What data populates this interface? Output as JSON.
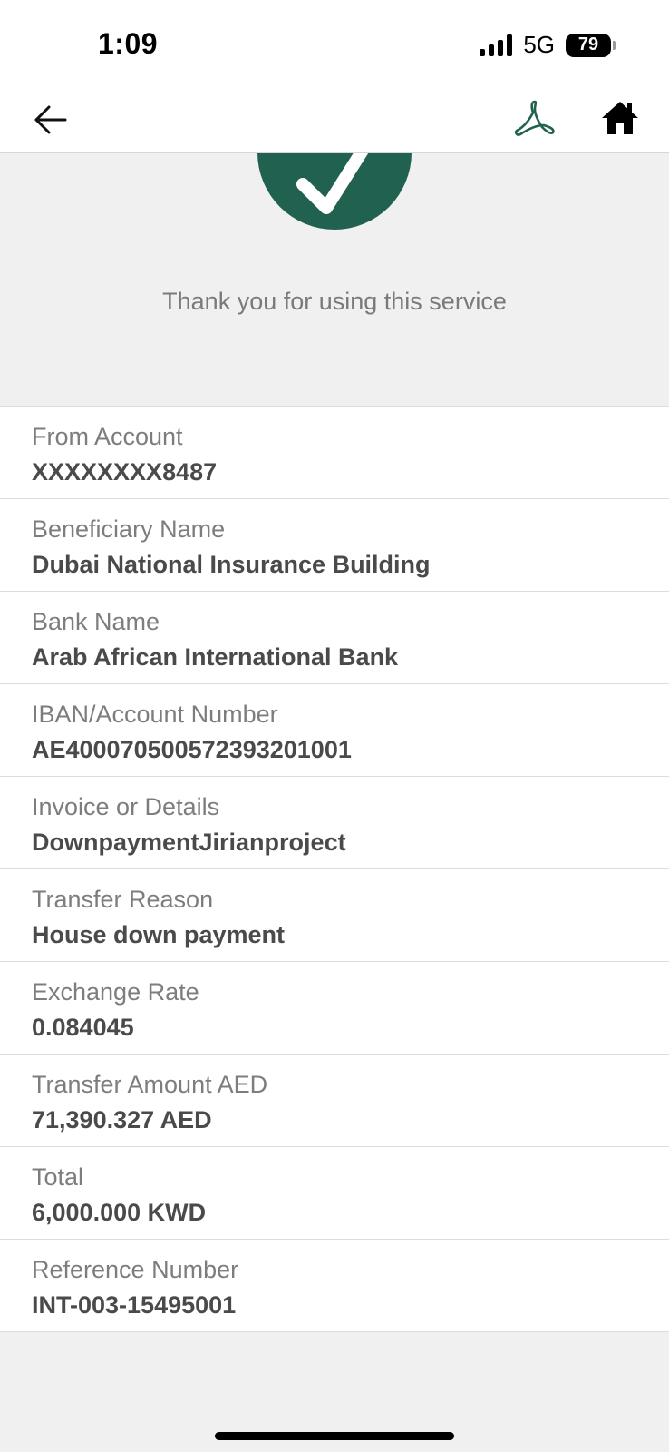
{
  "status_bar": {
    "time": "1:09",
    "network": "5G",
    "battery": "79"
  },
  "nav": {
    "back_icon": "back-arrow-icon",
    "pdf_icon": "pdf-icon",
    "home_icon": "home-icon",
    "accent_color": "#216150"
  },
  "success": {
    "icon": "checkmark-icon",
    "message": "Thank you for using this service"
  },
  "details": [
    {
      "label": "From Account",
      "value": "XXXXXXXX8487"
    },
    {
      "label": "Beneficiary Name",
      "value": "Dubai National Insurance Building"
    },
    {
      "label": "Bank Name",
      "value": "Arab African International Bank"
    },
    {
      "label": "IBAN/Account Number",
      "value": "AE400070500572393201001"
    },
    {
      "label": "Invoice or Details",
      "value": "DownpaymentJirianproject"
    },
    {
      "label": "Transfer Reason",
      "value": "House down payment"
    },
    {
      "label": "Exchange Rate",
      "value": "0.084045"
    },
    {
      "label": "Transfer Amount AED",
      "value": "71,390.327 AED"
    },
    {
      "label": "Total",
      "value": "6,000.000 KWD"
    },
    {
      "label": "Reference Number",
      "value": "INT-003-15495001"
    }
  ]
}
